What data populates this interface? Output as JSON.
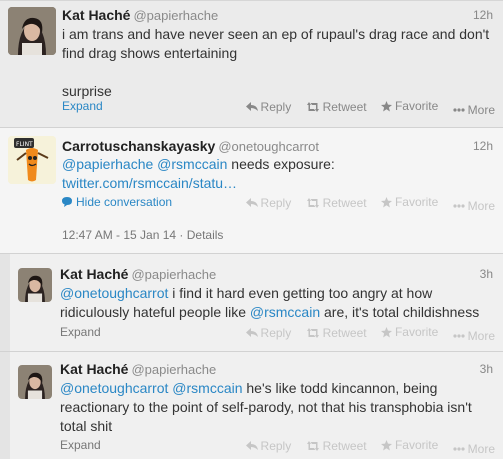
{
  "tweets": [
    {
      "fullname": "Kat Haché",
      "username": "@papierhache",
      "time": "12h",
      "text_lines": [
        "i am trans and have never seen an ep of rupaul's drag race and don't",
        "find drag shows entertaining",
        "",
        "surprise"
      ],
      "expand": "Expand",
      "actions": {
        "reply": "Reply",
        "retweet": "Retweet",
        "favorite": "Favorite",
        "more": "More"
      }
    },
    {
      "fullname": "Carrotuschanskayasky",
      "username": "@onetoughcarrot",
      "time": "12h",
      "mention1": "@papierhache",
      "mention2": "@rsmccain",
      "text_rest": " needs exposure:",
      "url": "twitter.com/rsmccain/statu…",
      "hide_conversation": "Hide conversation",
      "timestamp": "12:47 AM - 15 Jan 14 · Details",
      "avatar_label": "FLINT",
      "actions": {
        "reply": "Reply",
        "retweet": "Retweet",
        "favorite": "Favorite",
        "more": "More"
      }
    },
    {
      "fullname": "Kat Haché",
      "username": "@papierhache",
      "time": "3h",
      "mention1": "@onetoughcarrot",
      "line1_rest": " i find it hard even getting too angry at how",
      "line2_pre": "ridiculously hateful people like ",
      "mention2": "@rsmccain",
      "line2_rest": " are, it's total childishness",
      "expand": "Expand",
      "actions": {
        "reply": "Reply",
        "retweet": "Retweet",
        "favorite": "Favorite",
        "more": "More"
      }
    },
    {
      "fullname": "Kat Haché",
      "username": "@papierhache",
      "time": "3h",
      "mention1": "@onetoughcarrot",
      "mention2": "@rsmccain",
      "line1_rest": " he's like todd kincannon, being",
      "line2": "reactionary to the point of self-parody, not that his transphobia isn't",
      "line3": "total shit",
      "expand": "Expand",
      "actions": {
        "reply": "Reply",
        "retweet": "Retweet",
        "favorite": "Favorite",
        "more": "More"
      }
    }
  ]
}
